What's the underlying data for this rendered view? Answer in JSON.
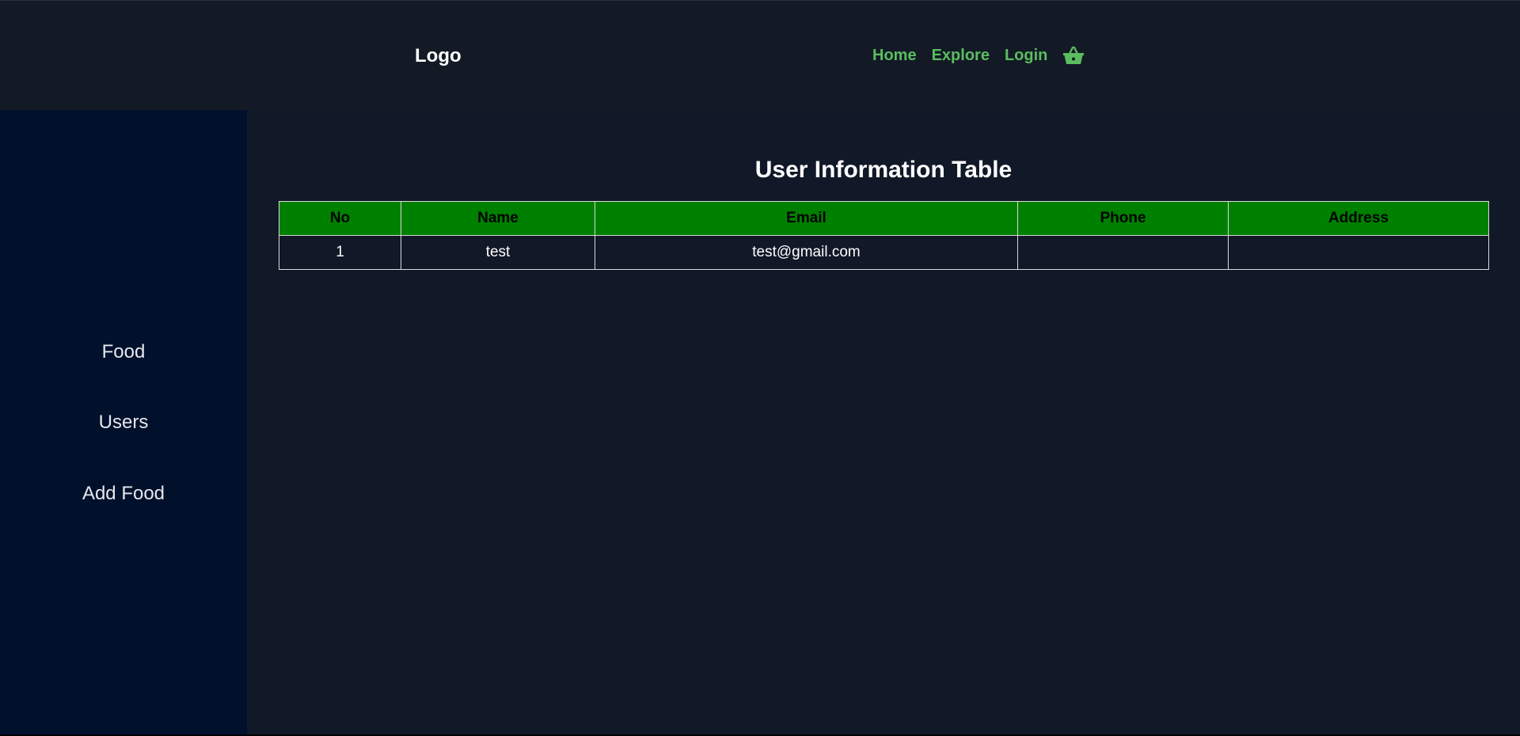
{
  "header": {
    "logo": "Logo",
    "nav": [
      {
        "label": "Home"
      },
      {
        "label": "Explore"
      },
      {
        "label": "Login"
      }
    ],
    "cart_icon": "basket-icon"
  },
  "sidebar": {
    "items": [
      {
        "label": "Food"
      },
      {
        "label": "Users"
      },
      {
        "label": "Add Food"
      }
    ]
  },
  "main": {
    "title": "User Information Table",
    "table": {
      "columns": [
        "No",
        "Name",
        "Email",
        "Phone",
        "Address"
      ],
      "rows": [
        [
          "1",
          "test",
          "test@gmail.com",
          "",
          ""
        ]
      ]
    }
  },
  "colors": {
    "background": "#111827",
    "header_bg": "#131a26",
    "sidebar_bg": "#01112c",
    "nav_link": "#5bbd5f",
    "table_header_bg": "#008000"
  }
}
